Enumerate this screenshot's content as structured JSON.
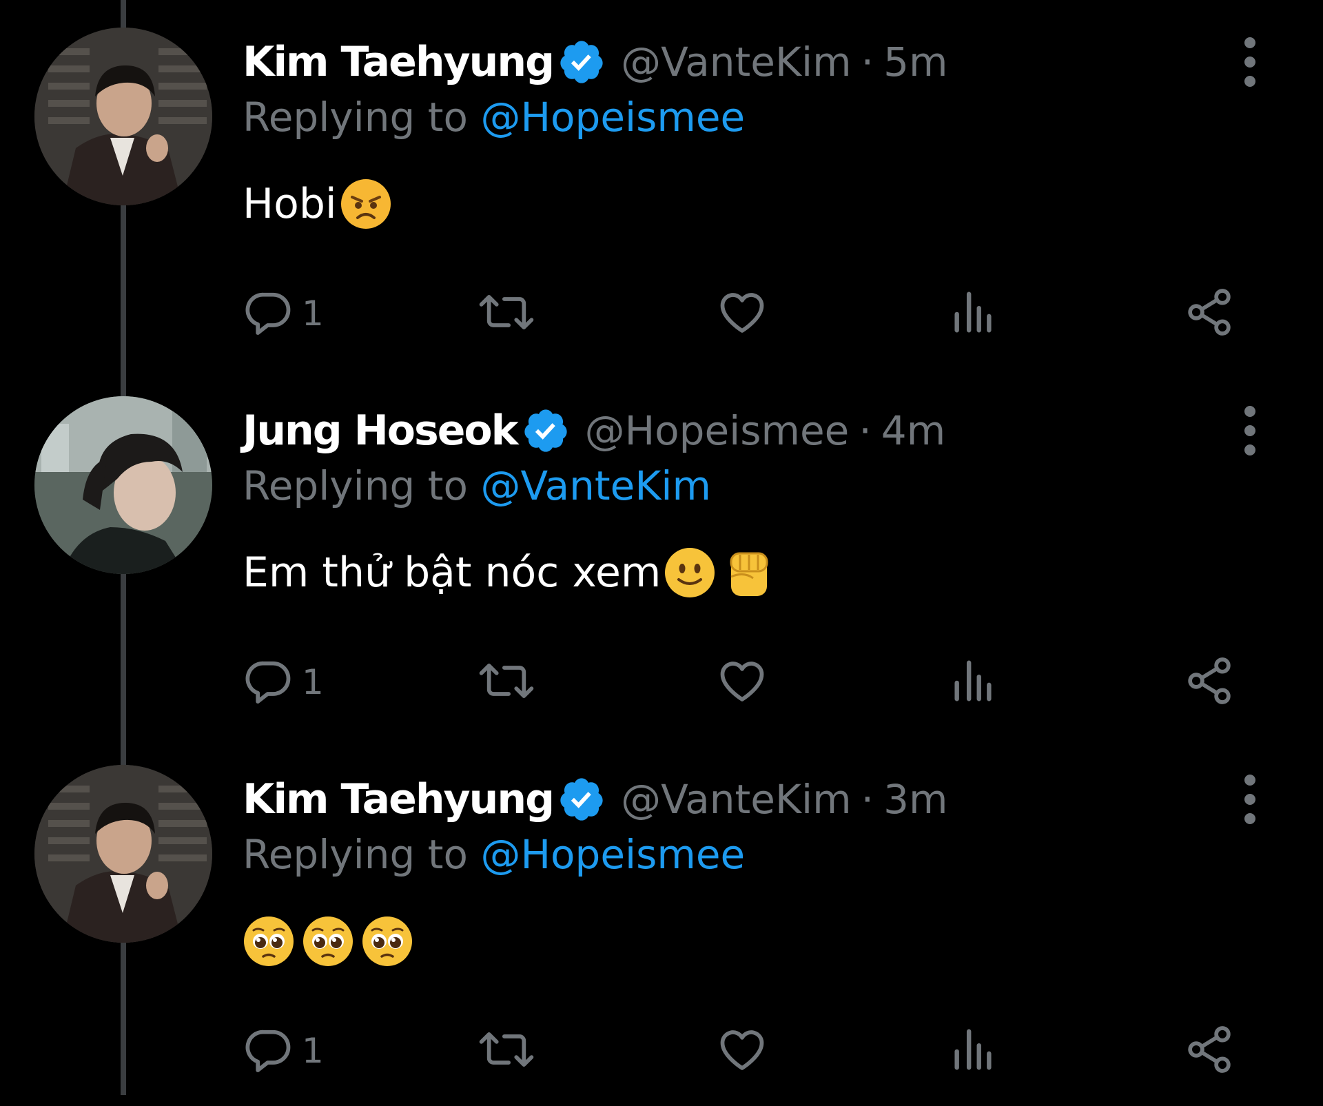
{
  "colors": {
    "background": "#000000",
    "text_primary": "#ffffff",
    "text_secondary": "#71767b",
    "accent": "#1d9bf0",
    "thread_line": "#3a3d40"
  },
  "tweets": [
    {
      "display_name": "Kim Taehyung",
      "verified_icon": "verified-badge-icon",
      "handle": "@VanteKim",
      "separator": "·",
      "timestamp": "5m",
      "replying_prefix": "Replying to",
      "replying_handle": "@Hopeismee",
      "text": "Hobi",
      "emojis": [
        "angry-face-icon"
      ],
      "reply_count": "1"
    },
    {
      "display_name": "Jung Hoseok",
      "verified_icon": "verified-badge-icon",
      "handle": "@Hopeismee",
      "separator": "·",
      "timestamp": "4m",
      "replying_prefix": "Replying to",
      "replying_handle": "@VanteKim",
      "text": "Em thử bật nóc xem",
      "emojis": [
        "slightly-smiling-face-icon",
        "raised-fist-icon"
      ],
      "reply_count": "1"
    },
    {
      "display_name": "Kim Taehyung",
      "verified_icon": "verified-badge-icon",
      "handle": "@VanteKim",
      "separator": "·",
      "timestamp": "3m",
      "replying_prefix": "Replying to",
      "replying_handle": "@Hopeismee",
      "text": "",
      "emojis": [
        "pleading-face-icon",
        "pleading-face-icon",
        "pleading-face-icon"
      ],
      "reply_count": "1"
    }
  ],
  "action_icons": [
    "reply-icon",
    "retweet-icon",
    "like-icon",
    "views-icon",
    "share-icon"
  ]
}
